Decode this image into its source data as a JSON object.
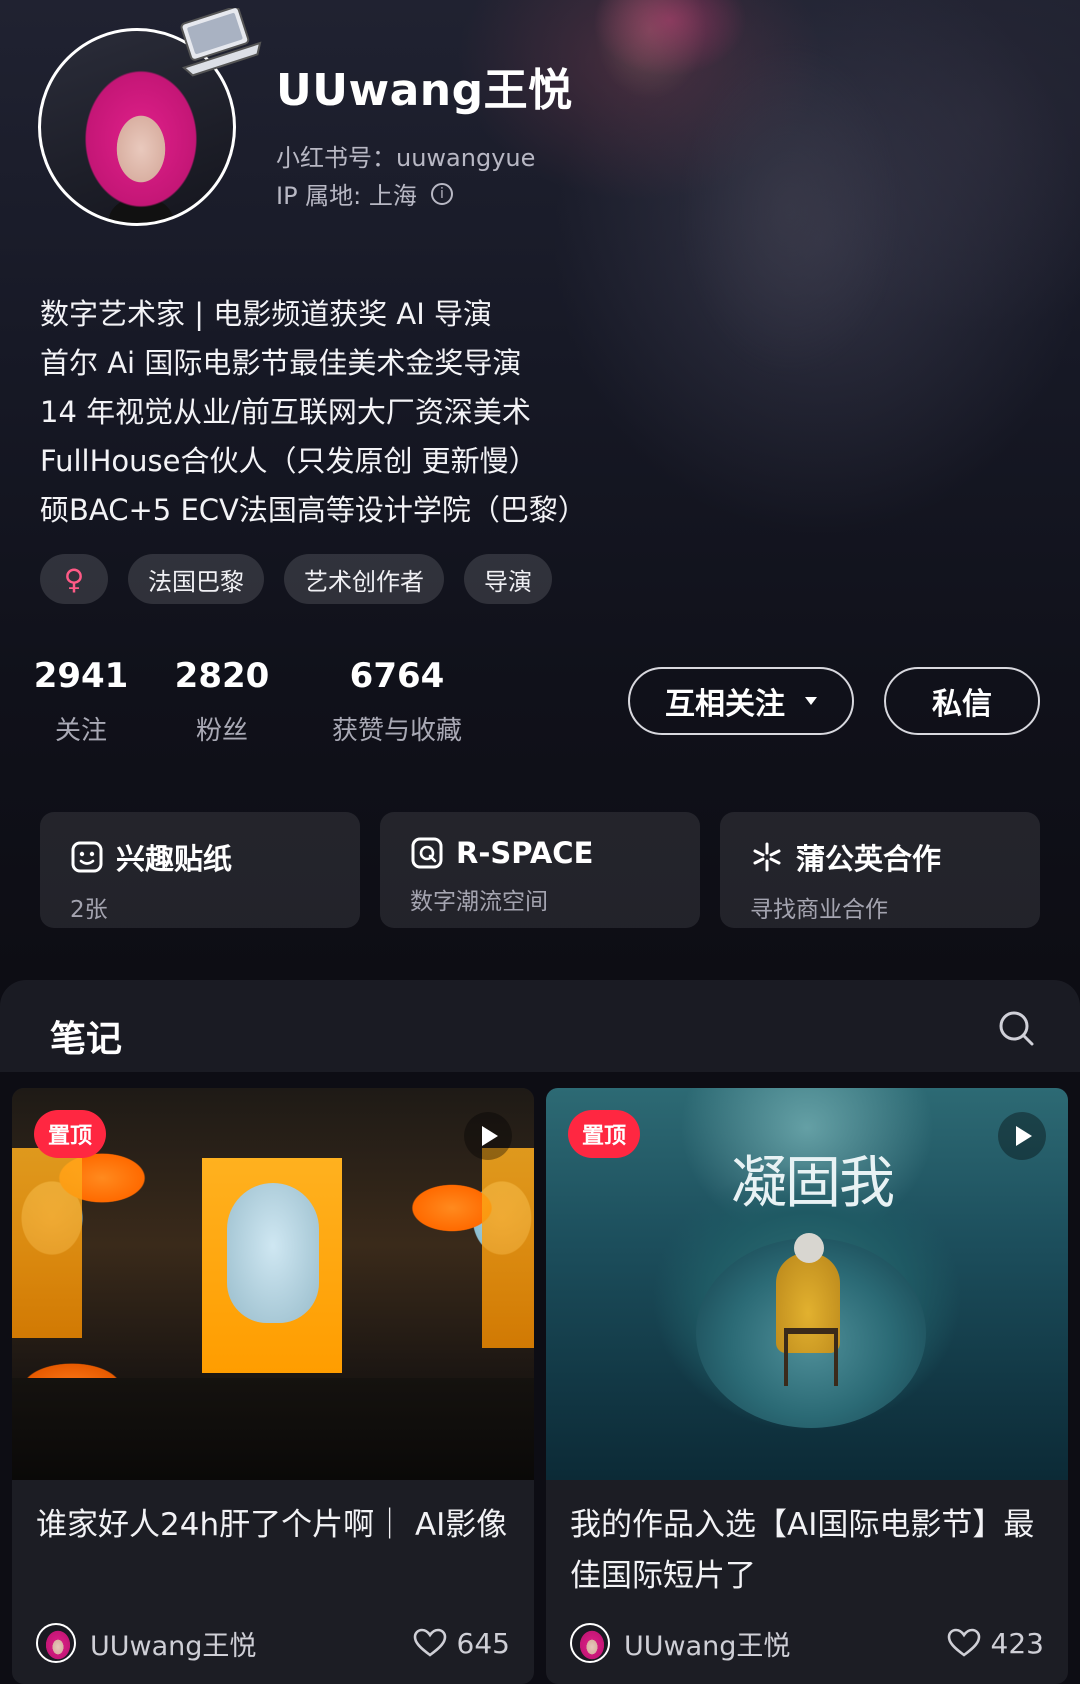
{
  "profile": {
    "username": "UUwang王悦",
    "red_id": "小红书号：uuwangyue",
    "ip_location": "IP 属地: 上海",
    "bio_lines": [
      "数字艺术家 | 电影频道获奖 AI 导演",
      "首尔 Ai 国际电影节最佳美术金奖导演",
      "14 年视觉从业/前互联网大厂资深美术",
      "FullHouse合伙人（只发原创 更新慢）",
      "硕BAC+5 ECV法国高等设计学院（巴黎）"
    ],
    "tags": [
      "♀",
      "法国巴黎",
      "艺术创作者",
      "导演"
    ]
  },
  "stats": [
    {
      "num": "2941",
      "label": "关注"
    },
    {
      "num": "2820",
      "label": "粉丝"
    },
    {
      "num": "6764",
      "label": "获赞与收藏"
    }
  ],
  "actions": {
    "follow_label": "互相关注",
    "message_label": "私信"
  },
  "cards": [
    {
      "icon": "sticker-face-icon",
      "title": "兴趣贴纸",
      "sub": "2张"
    },
    {
      "icon": "r-space-icon",
      "title": "R-SPACE",
      "sub": "数字潮流空间"
    },
    {
      "icon": "dandelion-icon",
      "title": "蒲公英合作",
      "sub": "寻找商业合作"
    }
  ],
  "notes": {
    "section_title": "笔记",
    "posts": [
      {
        "pin_label": "置顶",
        "title": "谁家好人24h肝了个片啊｜ AI影像",
        "author": "UUwang王悦",
        "likes": "645"
      },
      {
        "pin_label": "置顶",
        "poster_text": "凝固我",
        "title": "我的作品入选【AI国际电影节】最佳国际短片了",
        "author": "UUwang王悦",
        "likes": "423"
      }
    ]
  },
  "colors": {
    "accent_red": "#ff2741",
    "gender_pink": "#ff5a86",
    "background": "#0d0d14"
  }
}
